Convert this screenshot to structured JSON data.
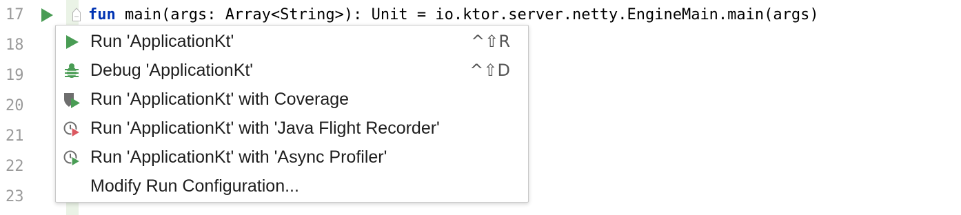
{
  "editor": {
    "line_numbers": [
      "17",
      "18",
      "19",
      "20",
      "21",
      "22",
      "23"
    ],
    "code": {
      "keyword": "fun",
      "rest": " main(args: Array<String>): Unit = io.ktor.server.netty.EngineMain.main(args)"
    },
    "gutter_icon": "run-gutter-icon"
  },
  "popup": {
    "items": [
      {
        "label": "Run 'ApplicationKt'",
        "shortcut": "^⇧R",
        "icon": "run-icon"
      },
      {
        "label": "Debug 'ApplicationKt'",
        "shortcut": "^⇧D",
        "icon": "debug-bug-icon"
      },
      {
        "label": "Run 'ApplicationKt' with Coverage",
        "shortcut": "",
        "icon": "coverage-shield-icon"
      },
      {
        "label": "Run 'ApplicationKt' with 'Java Flight Recorder'",
        "shortcut": "",
        "icon": "profiler-flight-recorder-icon"
      },
      {
        "label": "Run 'ApplicationKt' with 'Async Profiler'",
        "shortcut": "",
        "icon": "profiler-async-icon"
      },
      {
        "label": "Modify Run Configuration...",
        "shortcut": "",
        "icon": ""
      }
    ]
  },
  "colors": {
    "run_green": "#499c54",
    "profiler_red": "#db5860",
    "keyword_blue": "#0033b3",
    "gray_icon": "#6e6e6e"
  }
}
